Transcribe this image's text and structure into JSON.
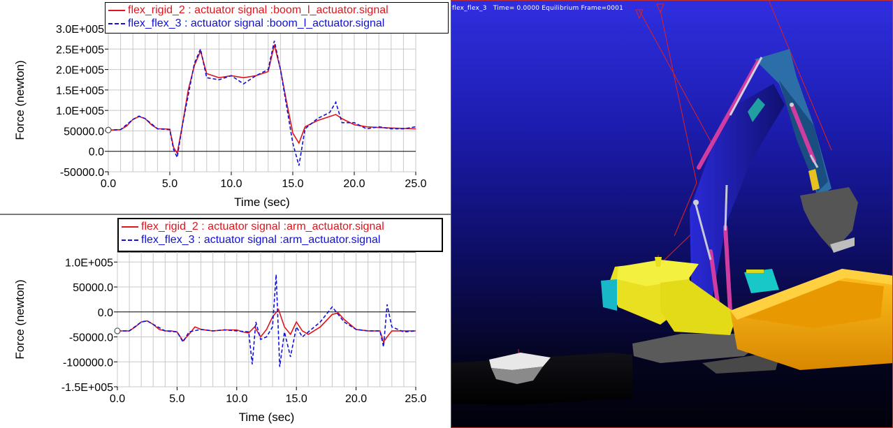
{
  "plots": [
    {
      "legend": [
        {
          "label": "flex_rigid_2 : actuator signal :boom_l_actuator.signal",
          "style": "solid",
          "color": "#e0141c"
        },
        {
          "label": "flex_flex_3 : actuator signal :boom_l_actuator.signal",
          "style": "dashed",
          "color": "#1010d8"
        }
      ],
      "xlabel": "Time (sec)",
      "ylabel": "Force (newton)",
      "xticks": [
        "0.0",
        "5.0",
        "10.0",
        "15.0",
        "20.0",
        "25.0"
      ],
      "yticks": [
        "-50000.0",
        "0.0",
        "50000.0",
        "1.0E+005",
        "1.5E+005",
        "2.0E+005",
        "2.5E+005",
        "3.0E+005"
      ]
    },
    {
      "legend": [
        {
          "label": "flex_rigid_2 : actuator signal :arm_actuator.signal",
          "style": "solid",
          "color": "#e0141c"
        },
        {
          "label": "flex_flex_3 : actuator signal :arm_actuator.signal",
          "style": "dashed",
          "color": "#1010d8"
        }
      ],
      "xlabel": "Time (sec)",
      "ylabel": "Force (newton)",
      "xticks": [
        "0.0",
        "5.0",
        "10.0",
        "15.0",
        "20.0",
        "25.0"
      ],
      "yticks": [
        "-1.5E+005",
        "-100000.0",
        "-50000.0",
        "0.0",
        "50000.0",
        "1.0E+005"
      ]
    }
  ],
  "chart_data": [
    {
      "type": "line",
      "xlabel": "Time (sec)",
      "ylabel": "Force (newton)",
      "xlim": [
        0,
        25
      ],
      "ylim": [
        -50000,
        300000
      ],
      "series": [
        {
          "name": "flex_rigid_2 : actuator signal :boom_l_actuator.signal",
          "color": "#e0141c",
          "x": [
            0,
            1,
            1.5,
            2,
            2.5,
            3,
            3.5,
            4,
            4.5,
            5,
            5.3,
            5.6,
            6,
            6.5,
            7,
            7.5,
            8,
            9,
            10,
            11,
            12,
            13,
            13.5,
            14,
            14.5,
            15,
            15.5,
            16,
            17,
            18,
            18.5,
            19,
            20,
            21,
            22,
            23,
            24,
            25
          ],
          "y": [
            52000,
            53000,
            62000,
            78000,
            85000,
            80000,
            65000,
            55000,
            55000,
            54000,
            10000,
            -5000,
            60000,
            150000,
            210000,
            245000,
            190000,
            180000,
            185000,
            180000,
            185000,
            195000,
            260000,
            200000,
            120000,
            45000,
            20000,
            60000,
            75000,
            85000,
            90000,
            80000,
            65000,
            60000,
            58000,
            57000,
            56000,
            55000
          ]
        },
        {
          "name": "flex_flex_3 : actuator signal :boom_l_actuator.signal",
          "color": "#1010d8",
          "x": [
            0,
            1,
            2,
            2.5,
            3,
            4,
            5,
            5.3,
            5.6,
            6,
            7,
            7.5,
            8,
            9,
            10,
            11,
            12,
            13,
            13.5,
            14,
            14.5,
            15,
            15.5,
            16,
            17,
            18,
            18.5,
            19,
            20,
            21,
            22,
            23,
            24,
            25
          ],
          "y": [
            52000,
            53000,
            78000,
            86000,
            80000,
            55000,
            53000,
            5000,
            -15000,
            60000,
            215000,
            250000,
            180000,
            175000,
            185000,
            165000,
            185000,
            200000,
            270000,
            200000,
            110000,
            20000,
            -35000,
            55000,
            80000,
            95000,
            120000,
            70000,
            70000,
            55000,
            60000,
            55000,
            55000,
            60000
          ]
        }
      ]
    },
    {
      "type": "line",
      "xlabel": "Time (sec)",
      "ylabel": "Force (newton)",
      "xlim": [
        0,
        25
      ],
      "ylim": [
        -150000,
        120000
      ],
      "series": [
        {
          "name": "flex_rigid_2 : actuator signal :arm_actuator.signal",
          "color": "#e0141c",
          "x": [
            0,
            1,
            1.5,
            2,
            2.5,
            3,
            3.5,
            4,
            4.5,
            5,
            5.5,
            6,
            6.5,
            7,
            8,
            9,
            10,
            10.5,
            11,
            11.5,
            12,
            12.5,
            13,
            13.5,
            14,
            14.5,
            15,
            15.5,
            16,
            17,
            18,
            18.5,
            19,
            20,
            21,
            22,
            22.3,
            22.6,
            23,
            24,
            25
          ],
          "y": [
            -38000,
            -38000,
            -30000,
            -20000,
            -18000,
            -25000,
            -35000,
            -38000,
            -38000,
            -40000,
            -58000,
            -45000,
            -30000,
            -35000,
            -38000,
            -36000,
            -36000,
            -40000,
            -42000,
            -30000,
            -50000,
            -35000,
            -10000,
            5000,
            -30000,
            -45000,
            -20000,
            -38000,
            -45000,
            -30000,
            -5000,
            -2000,
            -15000,
            -35000,
            -38000,
            -38000,
            -60000,
            -50000,
            -38000,
            -38000,
            -38000
          ]
        },
        {
          "name": "flex_flex_3 : actuator signal :arm_actuator.signal",
          "color": "#1010d8",
          "x": [
            0,
            1,
            2,
            2.5,
            3,
            4,
            5,
            5.5,
            6,
            7,
            8,
            9,
            10,
            11,
            11.3,
            11.6,
            12,
            12.5,
            13,
            13.3,
            13.6,
            14,
            14.5,
            15,
            15.5,
            16,
            17,
            18,
            18.5,
            19,
            20,
            21,
            22,
            22.3,
            22.6,
            23,
            24,
            25
          ],
          "y": [
            -38000,
            -38000,
            -20000,
            -18000,
            -25000,
            -38000,
            -40000,
            -60000,
            -40000,
            -35000,
            -38000,
            -36000,
            -38000,
            -40000,
            -105000,
            -20000,
            -55000,
            -50000,
            -30000,
            75000,
            -110000,
            -40000,
            -90000,
            -30000,
            -50000,
            -40000,
            -20000,
            10000,
            -5000,
            -20000,
            -35000,
            -38000,
            -38000,
            -70000,
            15000,
            -30000,
            -40000,
            -38000
          ]
        }
      ]
    }
  ],
  "viewport": {
    "header_model": "flex_flex_3",
    "header_time_label": "Time=",
    "header_time_value": "0.0000",
    "header_status": "Equilibrium",
    "header_frame": "Frame=0001"
  }
}
